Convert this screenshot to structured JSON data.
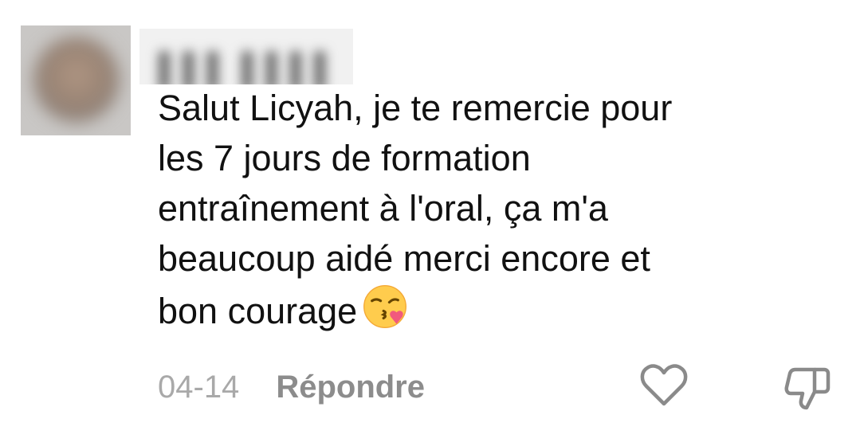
{
  "comment": {
    "author_name": "▌▌▌ ▌▌▌▌",
    "lines": [
      "Salut Licyah, je te remercie pour",
      "les 7 jours de formation",
      "entraînement à l'oral, ça m'a",
      "beaucoup aidé merci encore et",
      "bon courage"
    ],
    "emoji_icon": "face-blowing-kiss-icon",
    "date": "04-14",
    "reply_label": "Répondre",
    "like_icon": "heart-outline-icon",
    "dislike_icon": "thumbs-down-outline-icon"
  },
  "colors": {
    "text": "#111111",
    "date": "#a9a9a9",
    "reply": "#8c8c8c",
    "icon": "#8a8a8a"
  }
}
